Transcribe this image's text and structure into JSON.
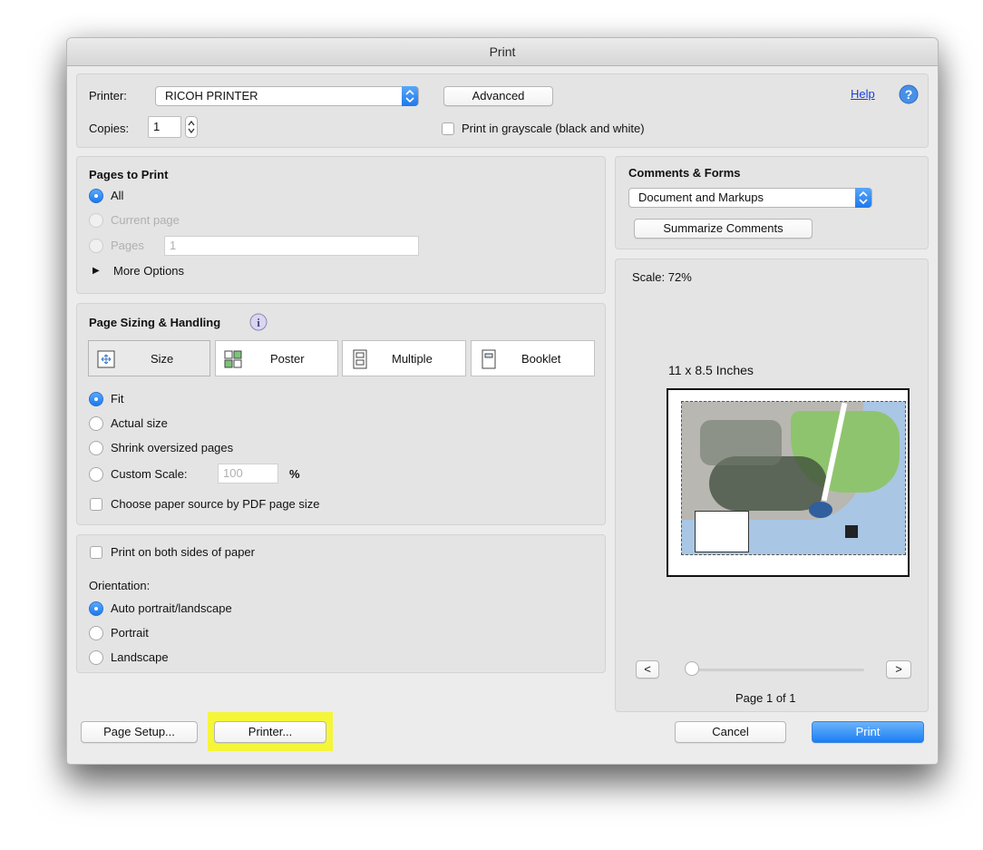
{
  "window": {
    "title": "Print"
  },
  "header": {
    "printer_label": "Printer:",
    "printer_value": "RICOH PRINTER",
    "advanced_label": "Advanced",
    "help_label": "Help",
    "copies_label": "Copies:",
    "copies_value": "1",
    "grayscale_label": "Print in grayscale (black and white)",
    "grayscale_checked": false
  },
  "pages_to_print": {
    "title": "Pages to Print",
    "all_label": "All",
    "current_page_label": "Current page",
    "pages_label": "Pages",
    "pages_value": "1",
    "more_options_label": "More Options",
    "selected": "All"
  },
  "page_sizing": {
    "title": "Page Sizing & Handling",
    "tabs": [
      {
        "label": "Size",
        "icon": "size-icon",
        "selected": true
      },
      {
        "label": "Poster",
        "icon": "poster-icon",
        "selected": false
      },
      {
        "label": "Multiple",
        "icon": "multiple-icon",
        "selected": false
      },
      {
        "label": "Booklet",
        "icon": "booklet-icon",
        "selected": false
      }
    ],
    "fit_label": "Fit",
    "actual_size_label": "Actual size",
    "shrink_label": "Shrink oversized pages",
    "custom_scale_label": "Custom Scale:",
    "custom_scale_value": "100",
    "percent_label": "%",
    "paper_source_label": "Choose paper source by PDF page size",
    "selected": "Fit"
  },
  "orientation_panel": {
    "both_sides_label": "Print on both sides of paper",
    "orientation_label": "Orientation:",
    "auto_label": "Auto portrait/landscape",
    "portrait_label": "Portrait",
    "landscape_label": "Landscape",
    "selected": "Auto portrait/landscape"
  },
  "comments_forms": {
    "title": "Comments & Forms",
    "select_value": "Document and Markups",
    "summarize_label": "Summarize Comments"
  },
  "preview": {
    "scale_label": "Scale:  72%",
    "paper_size_label": "11 x 8.5 Inches",
    "prev_label": "<",
    "next_label": ">",
    "page_indicator": "Page 1 of 1",
    "slider_position": 0
  },
  "footer": {
    "page_setup_label": "Page Setup...",
    "printer_button_label": "Printer...",
    "cancel_label": "Cancel",
    "print_label": "Print"
  },
  "colors": {
    "accent": "#1c7cf2",
    "highlight": "#f7f739",
    "help_link": "#1a3fd9"
  }
}
